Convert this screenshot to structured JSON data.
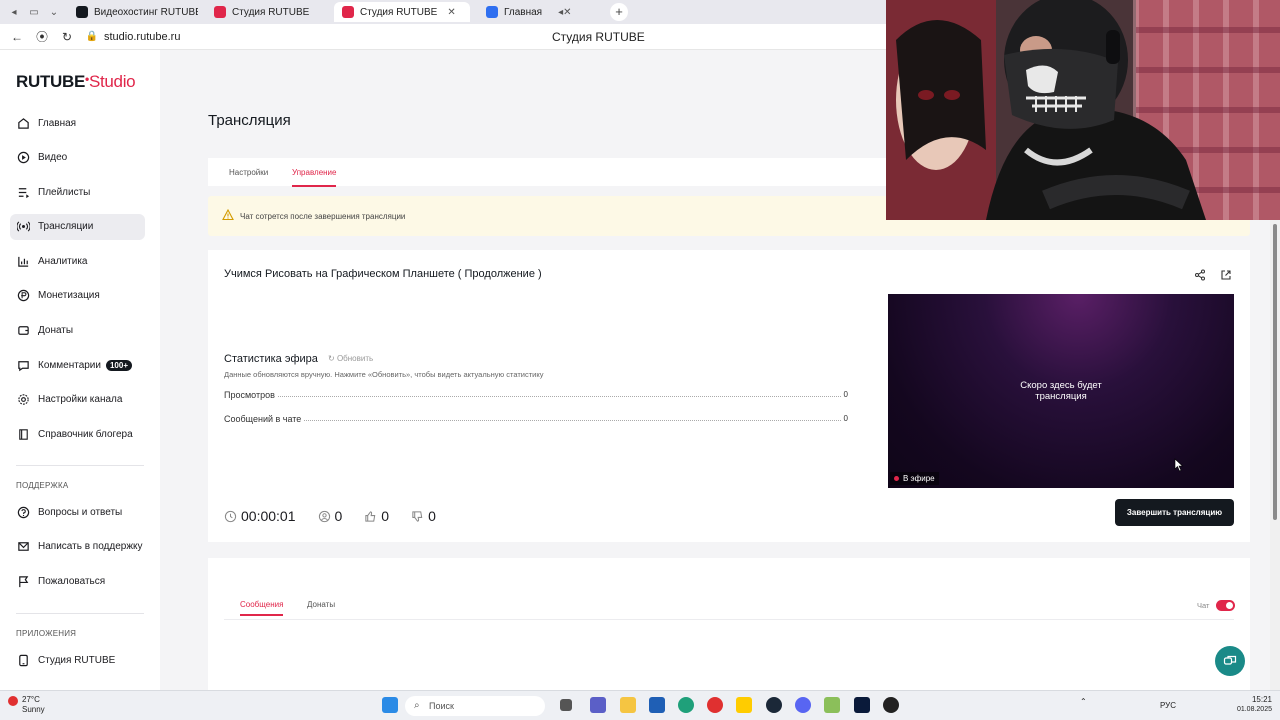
{
  "browser": {
    "tabs": [
      {
        "label": "Видеохостинг RUTUBE. С"
      },
      {
        "label": "Студия RUTUBE"
      },
      {
        "label": "Студия RUTUBE",
        "active": true
      },
      {
        "label": "Главная"
      }
    ],
    "url": "studio.rutube.ru",
    "page_title": "Студия RUTUBE"
  },
  "sidebar": {
    "logo_main": "RUTUBE",
    "logo_studio": "Studio",
    "items": [
      {
        "label": "Главная",
        "icon": "home-icon"
      },
      {
        "label": "Видео",
        "icon": "video-icon"
      },
      {
        "label": "Плейлисты",
        "icon": "playlist-icon"
      },
      {
        "label": "Трансляции",
        "icon": "broadcast-icon",
        "active": true
      },
      {
        "label": "Аналитика",
        "icon": "chart-icon"
      },
      {
        "label": "Монетизация",
        "icon": "money-icon"
      },
      {
        "label": "Донаты",
        "icon": "donate-icon"
      },
      {
        "label": "Комментарии",
        "icon": "comments-icon",
        "badge": "100+"
      },
      {
        "label": "Настройки канала",
        "icon": "gear-icon"
      },
      {
        "label": "Справочник блогера",
        "icon": "book-icon"
      }
    ],
    "support_heading": "ПОДДЕРЖКА",
    "support_items": [
      {
        "label": "Вопросы и ответы",
        "icon": "help-icon"
      },
      {
        "label": "Написать в поддержку",
        "icon": "mail-icon"
      },
      {
        "label": "Пожаловаться",
        "icon": "flag-icon"
      }
    ],
    "apps_heading": "ПРИЛОЖЕНИЯ",
    "apps_items": [
      {
        "label": "Студия RUTUBE",
        "icon": "studio-app-icon"
      }
    ]
  },
  "main": {
    "title": "Трансляция",
    "subtabs": [
      "Настройки",
      "Управление"
    ],
    "active_subtab": "Управление",
    "warning": "Чат сотрется после завершения трансляции",
    "stream": {
      "title": "Учимся Рисовать на Графическом Планшете ( Продолжение )",
      "stats_title": "Статистика эфира",
      "refresh_label": "Обновить",
      "stats_note": "Данные обновляются вручную. Нажмите «Обновить», чтобы видеть актуальную статистику",
      "stats": [
        {
          "label": "Просмотров",
          "value": "0"
        },
        {
          "label": "Сообщений в чате",
          "value": "0"
        }
      ],
      "duration": "00:00:01",
      "viewers": "0",
      "likes": "0",
      "dislikes": "0",
      "player_text_line1": "Скоро здесь будет",
      "player_text_line2": "трансляция",
      "live_label": "В эфире",
      "end_button": "Завершить трансляцию"
    },
    "chat": {
      "tabs": [
        "Сообщения",
        "Донаты"
      ],
      "active_tab": "Сообщения",
      "toggle_label": "Чат",
      "toggle_on": true
    }
  },
  "taskbar": {
    "temp": "27°C",
    "weather": "Sunny",
    "search_placeholder": "Поиск",
    "lang": "РУС",
    "time": "15:21",
    "date": "01.08.2025"
  },
  "colors": {
    "accent": "#e0264a",
    "dark": "#14191f",
    "warning_bg": "#fdf9e6"
  }
}
